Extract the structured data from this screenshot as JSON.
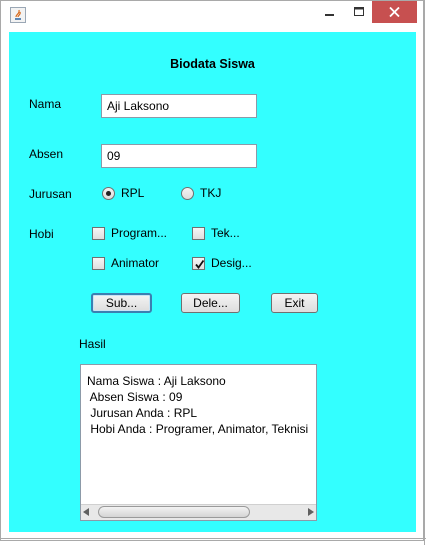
{
  "window": {
    "title": "",
    "controls": {
      "minimize": "minimize-icon",
      "maximize": "maximize-icon",
      "close": "close-icon"
    },
    "close_color": "#c75050"
  },
  "panel": {
    "background": "#33ffff"
  },
  "form": {
    "title": "Biodata Siswa",
    "nama": {
      "label": "Nama",
      "value": "Aji Laksono"
    },
    "absen": {
      "label": "Absen",
      "value": "09"
    },
    "jurusan": {
      "label": "Jurusan",
      "options": [
        {
          "label": "RPL",
          "selected": true
        },
        {
          "label": "TKJ",
          "selected": false
        }
      ]
    },
    "hobi": {
      "label": "Hobi",
      "options": [
        {
          "label": "Program...",
          "checked": false
        },
        {
          "label": "Tek...",
          "checked": false
        },
        {
          "label": "Animator",
          "checked": false
        },
        {
          "label": "Desig...",
          "checked": true
        }
      ]
    },
    "buttons": {
      "submit": "Sub...",
      "delete": "Dele...",
      "exit": "Exit"
    },
    "hasil_label": "Hasil",
    "hasil_text": "Nama Siswa : Aji Laksono\n Absen Siswa : 09\n Jurusan Anda : RPL\n Hobi Anda : Programer, Animator, Teknisi"
  }
}
